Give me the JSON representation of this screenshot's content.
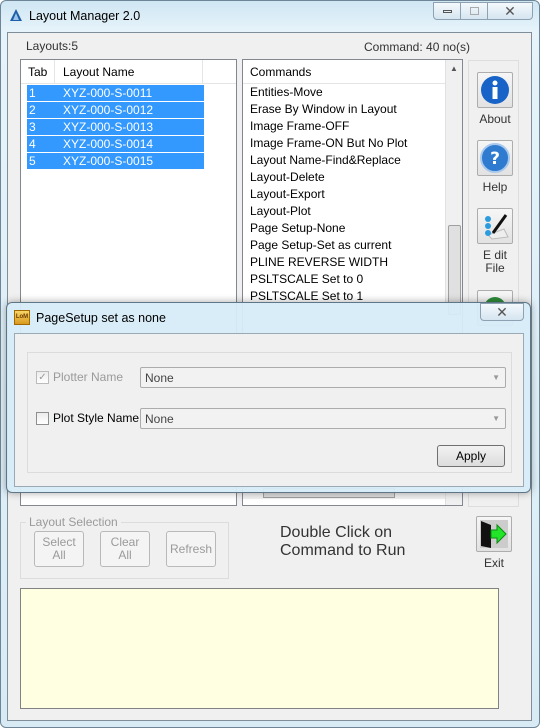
{
  "window": {
    "title": "Layout Manager  2.0",
    "minimize": "minimize",
    "maximize": "maximize",
    "close": "close"
  },
  "layouts_count": "Layouts:5",
  "command_count": "Command: 40 no(s)",
  "layout_list": {
    "columns": [
      "Tab",
      "Layout Name"
    ],
    "rows": [
      {
        "tab": "1",
        "name": "XYZ-000-S-0011",
        "selected": true
      },
      {
        "tab": "2",
        "name": "XYZ-000-S-0012",
        "selected": true
      },
      {
        "tab": "3",
        "name": "XYZ-000-S-0013",
        "selected": true
      },
      {
        "tab": "4",
        "name": "XYZ-000-S-0014",
        "selected": true
      },
      {
        "tab": "5",
        "name": "XYZ-000-S-0015",
        "selected": true
      }
    ]
  },
  "commands": {
    "header": "Commands",
    "items": [
      "Entities-Move",
      "Erase By Window in Layout",
      "Image Frame-OFF",
      "Image Frame-ON But No Plot",
      "Layout Name-Find&Replace",
      "Layout-Delete",
      "Layout-Export",
      "Layout-Plot",
      "Page Setup-None",
      "Page Setup-Set as current",
      "PLINE REVERSE WIDTH",
      "PSLTSCALE Set to 0",
      "PSLTSCALE Set to 1"
    ]
  },
  "side_buttons": [
    {
      "label": "About",
      "icon": "info-icon"
    },
    {
      "label": "Help",
      "icon": "help-icon"
    },
    {
      "label_line1": "E dit",
      "label_line2": "File",
      "icon": "edit-file-icon"
    }
  ],
  "dialog": {
    "title": "PageSetup set as none",
    "plotter": {
      "label": "Plotter Name",
      "checked": true,
      "disabled": true,
      "value": "None"
    },
    "plot_style": {
      "label": "Plot Style Name",
      "checked": false,
      "value": "None"
    },
    "apply": "Apply"
  },
  "layout_selection": {
    "title": "Layout Selection",
    "select_all": [
      "Select",
      "All"
    ],
    "clear_all": [
      "Clear",
      "All"
    ],
    "refresh": "Refresh"
  },
  "hint": {
    "line1": "Double Click on",
    "line2": "Command to Run"
  },
  "exit": "Exit",
  "colors": {
    "selection": "#3399ff",
    "output_bg": "#ffffe1"
  }
}
